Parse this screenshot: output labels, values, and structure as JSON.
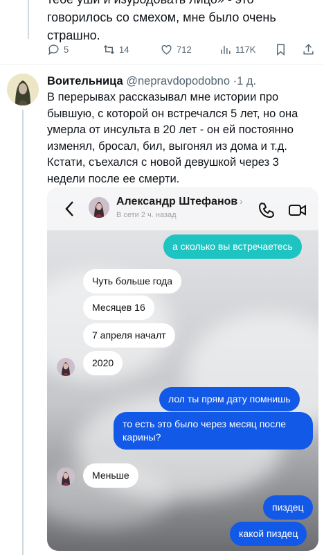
{
  "previous_tweet": {
    "lines": [
      "тебе уши и изуродовать лицо» - это",
      "говорилось со смехом, мне было очень",
      "страшно."
    ],
    "actions": {
      "replies": "5",
      "retweets": "14",
      "likes": "712",
      "views": "117K"
    }
  },
  "tweet": {
    "author_name": "Воительница",
    "handle": "@nepravdopodobno",
    "separator": "·",
    "time": "1 д.",
    "text": "В перерывах рассказывал мне  истории про бывшую, с которой он встречался 5 лет, но она умерла от инсульта в 20 лет - он ей постоянно изменял, бросал, бил, выгонял из дома и т.д. Кстати, съехался с новой девушкой через 3 недели после ее смерти."
  },
  "chat": {
    "contact_name": "Александр Штефанов",
    "chevron": "›",
    "status": "В сети 2 ч. назад",
    "messages": [
      {
        "from": "me",
        "style": "teal",
        "text": "а сколько вы встречаетесь"
      },
      {
        "from": "them",
        "text": "Чуть больше года"
      },
      {
        "from": "them",
        "text": "Месяцев 16"
      },
      {
        "from": "them",
        "text": "7 апреля началт"
      },
      {
        "from": "them",
        "text": "2020"
      },
      {
        "from": "me",
        "style": "blue",
        "text": "лол ты прям дату помнишь"
      },
      {
        "from": "me",
        "style": "blue",
        "text": "то есть это было через месяц после карины?"
      },
      {
        "from": "them",
        "text": "Меньше"
      },
      {
        "from": "me",
        "style": "blue",
        "text": "пиздец"
      },
      {
        "from": "me",
        "style": "blue",
        "text": "какой пиздец"
      }
    ]
  },
  "colors": {
    "text_primary": "#0f1419",
    "text_secondary": "#536471",
    "teal_bubble": "#1ec4c2",
    "blue_bubble": "#1259e8"
  },
  "icons": [
    "reply-icon",
    "retweet-icon",
    "like-icon",
    "views-icon",
    "bookmark-icon",
    "share-icon",
    "back-icon",
    "phone-icon",
    "video-icon"
  ]
}
